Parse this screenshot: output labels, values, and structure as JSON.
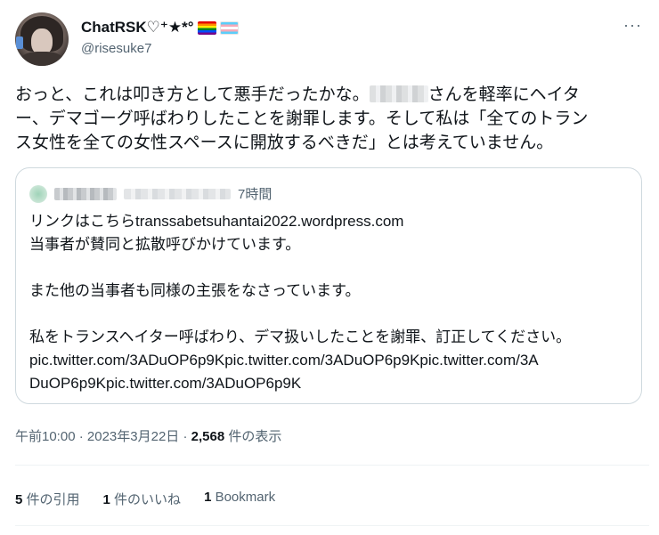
{
  "author": {
    "display_name": "ChatRSK♡⁺★*°",
    "handle": "@risesuke7",
    "flags": [
      "rainbow-flag-icon",
      "trans-flag-icon"
    ]
  },
  "menu": {
    "more_label": "···"
  },
  "tweet": {
    "line1_before": "おっと、これは叩き方として悪手だったかな。",
    "line1_after": "さんを軽率にヘイタ",
    "line2": "ー、デマゴーグ呼ばわりしたことを謝罪します。そして私は「全てのトラン",
    "line3": "ス女性を全ての女性スペースに開放するべきだ」とは考えていません。"
  },
  "quote": {
    "time": "7時間",
    "lines": [
      "リンクはこちらtranssabetsuhantai2022.wordpress.com",
      "当事者が賛同と拡散呼びかけています。",
      "",
      "また他の当事者も同様の主張をなさっています。",
      "",
      "私をトランスヘイター呼ばわり、デマ扱いしたことを謝罪、訂正してください。",
      "pic.twitter.com/3ADuOP6p9Kpic.twitter.com/3ADuOP6p9Kpic.twitter.com/3A",
      "DuOP6p9Kpic.twitter.com/3ADuOP6p9K"
    ]
  },
  "meta": {
    "time": "午前10:00",
    "date": "2023年3月22日",
    "views_count": "2,568",
    "views_label": "件の表示",
    "separator": "·"
  },
  "stats": {
    "quotes_count": "5",
    "quotes_label": "件の引用",
    "likes_count": "1",
    "likes_label": "件のいいね",
    "bookmarks_count": "1",
    "bookmarks_label": "Bookmark"
  },
  "colors": {
    "text": "#0f1419",
    "secondary": "#536471",
    "border": "#cfd9de"
  }
}
